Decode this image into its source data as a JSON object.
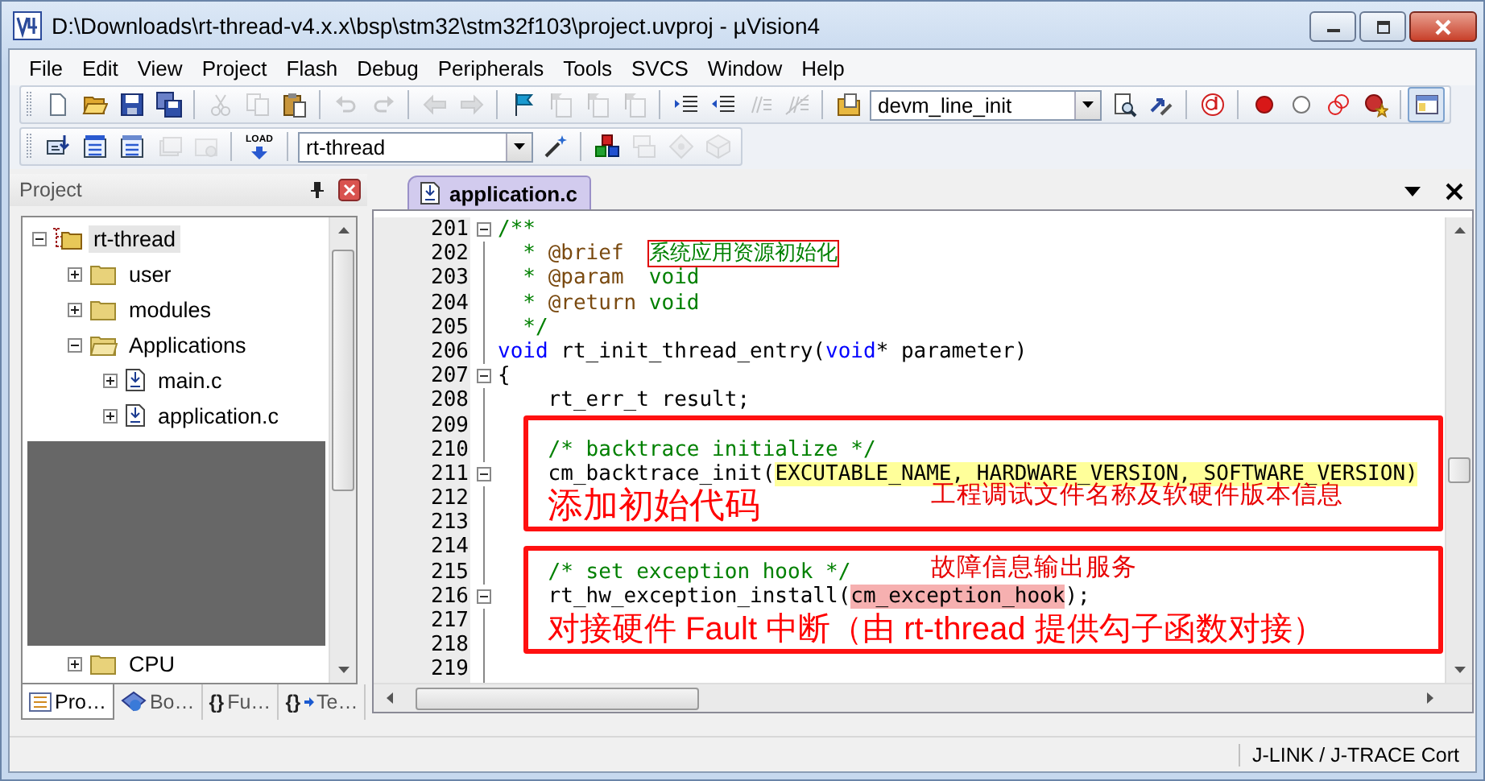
{
  "window": {
    "title": "D:\\Downloads\\rt-thread-v4.x.x\\bsp\\stm32\\stm32f103\\project.uvproj - µVision4"
  },
  "menu": [
    "File",
    "Edit",
    "View",
    "Project",
    "Flash",
    "Debug",
    "Peripherals",
    "Tools",
    "SVCS",
    "Window",
    "Help"
  ],
  "toolbars": [
    {
      "items": [
        {
          "kind": "new",
          "disabled": false,
          "pressed": false
        },
        {
          "kind": "open",
          "disabled": false,
          "pressed": false
        },
        {
          "kind": "save",
          "disabled": false,
          "pressed": false
        },
        {
          "kind": "saveall",
          "disabled": false,
          "pressed": false
        },
        {
          "kind": "separator"
        },
        {
          "kind": "cut",
          "disabled": true,
          "pressed": false
        },
        {
          "kind": "copy",
          "disabled": true,
          "pressed": false
        },
        {
          "kind": "paste",
          "disabled": false,
          "pressed": false
        },
        {
          "kind": "separator"
        },
        {
          "kind": "undo",
          "disabled": true,
          "pressed": false
        },
        {
          "kind": "redo",
          "disabled": true,
          "pressed": false
        },
        {
          "kind": "separator"
        },
        {
          "kind": "back",
          "disabled": true,
          "pressed": false
        },
        {
          "kind": "forward",
          "disabled": true,
          "pressed": false
        },
        {
          "kind": "separator"
        },
        {
          "kind": "bookmark",
          "disabled": false,
          "pressed": false
        },
        {
          "kind": "bmprev",
          "disabled": true,
          "pressed": false
        },
        {
          "kind": "bmnext",
          "disabled": true,
          "pressed": false
        },
        {
          "kind": "bmclear",
          "disabled": true,
          "pressed": false
        },
        {
          "kind": "separator"
        },
        {
          "kind": "indent",
          "disabled": false,
          "pressed": false
        },
        {
          "kind": "outdent",
          "disabled": false,
          "pressed": false
        },
        {
          "kind": "comment",
          "disabled": true,
          "pressed": false
        },
        {
          "kind": "uncomment",
          "disabled": true,
          "pressed": false
        },
        {
          "kind": "separator"
        },
        {
          "kind": "findfiles",
          "disabled": false,
          "pressed": false
        },
        {
          "kind": "dropdown",
          "value": "devm_line_init"
        },
        {
          "kind": "find",
          "disabled": false,
          "pressed": false
        },
        {
          "kind": "arrows",
          "disabled": false,
          "pressed": false
        },
        {
          "kind": "separator"
        },
        {
          "kind": "debug",
          "disabled": false,
          "pressed": false
        },
        {
          "kind": "separator"
        },
        {
          "kind": "bp",
          "disabled": false,
          "pressed": false
        },
        {
          "kind": "bpoff",
          "disabled": false,
          "pressed": false
        },
        {
          "kind": "bpdis",
          "disabled": false,
          "pressed": false
        },
        {
          "kind": "bpkill",
          "disabled": false,
          "pressed": false
        },
        {
          "kind": "separator"
        },
        {
          "kind": "winview",
          "disabled": false,
          "pressed": true
        }
      ]
    },
    {
      "items": [
        {
          "kind": "translate",
          "disabled": false,
          "pressed": false
        },
        {
          "kind": "build",
          "disabled": false,
          "pressed": false
        },
        {
          "kind": "rebuild",
          "disabled": false,
          "pressed": false
        },
        {
          "kind": "batch",
          "disabled": true,
          "pressed": false
        },
        {
          "kind": "stop",
          "disabled": true,
          "pressed": false
        },
        {
          "kind": "separator"
        },
        {
          "kind": "load",
          "label": "LOAD",
          "disabled": false,
          "pressed": false
        },
        {
          "kind": "separator"
        },
        {
          "kind": "dropdown",
          "value": "rt-thread"
        },
        {
          "kind": "wand",
          "disabled": false,
          "pressed": false
        },
        {
          "kind": "separator"
        },
        {
          "kind": "options",
          "disabled": false,
          "pressed": false
        },
        {
          "kind": "manage",
          "disabled": true,
          "pressed": false
        },
        {
          "kind": "pack",
          "disabled": true,
          "pressed": false
        },
        {
          "kind": "env",
          "disabled": true,
          "pressed": false
        }
      ]
    }
  ],
  "project": {
    "title": "Project",
    "tree": [
      {
        "label": "rt-thread",
        "kind": "project",
        "expanded": true,
        "selected": true,
        "children": [
          {
            "label": "user",
            "kind": "folder",
            "expanded": false,
            "selected": false
          },
          {
            "label": "modules",
            "kind": "folder",
            "expanded": false,
            "selected": false
          },
          {
            "label": "Applications",
            "kind": "folder",
            "expanded": true,
            "selected": false,
            "children": [
              {
                "label": "main.c",
                "kind": "file",
                "expanded": false,
                "selected": false
              },
              {
                "label": "application.c",
                "kind": "file",
                "expanded": false,
                "selected": false
              }
            ]
          },
          {
            "label": "CPU",
            "kind": "folder",
            "expanded": false,
            "selected": false
          }
        ]
      }
    ],
    "tabs": [
      {
        "label": "Pro…",
        "kind": "project",
        "selected": true
      },
      {
        "label": "Bo…",
        "kind": "books",
        "selected": false
      },
      {
        "label": "Fu…",
        "kind": "functions",
        "glyph": "{}",
        "selected": false
      },
      {
        "label": "Te…",
        "kind": "templates",
        "glyph": "{}",
        "selected": false
      }
    ]
  },
  "editor": {
    "tabs": [
      {
        "label": "application.c",
        "selected": true
      }
    ],
    "lines": [
      {
        "number": "201",
        "foldable": true,
        "tokens": [
          {
            "kind": "comment",
            "text": "/**"
          }
        ]
      },
      {
        "number": "202",
        "foldable": false,
        "tokens": [
          {
            "kind": "comment",
            "text": "  * "
          },
          {
            "kind": "doctag",
            "text": "@brief  "
          },
          {
            "kind": "boxed",
            "text": "系统应用资源初始化"
          }
        ]
      },
      {
        "number": "203",
        "foldable": false,
        "tokens": [
          {
            "kind": "comment",
            "text": "  * "
          },
          {
            "kind": "doctag",
            "text": "@param"
          },
          {
            "kind": "comment",
            "text": "  void"
          }
        ]
      },
      {
        "number": "204",
        "foldable": false,
        "tokens": [
          {
            "kind": "comment",
            "text": "  * "
          },
          {
            "kind": "doctag",
            "text": "@return"
          },
          {
            "kind": "comment",
            "text": " void"
          }
        ]
      },
      {
        "number": "205",
        "foldable": false,
        "tokens": [
          {
            "kind": "comment",
            "text": "  */"
          }
        ]
      },
      {
        "number": "206",
        "foldable": false,
        "tokens": [
          {
            "kind": "keyword",
            "text": "void"
          },
          {
            "kind": "plain",
            "text": " rt_init_thread_entry("
          },
          {
            "kind": "keyword",
            "text": "void"
          },
          {
            "kind": "plain",
            "text": "* parameter)"
          }
        ]
      },
      {
        "number": "207",
        "foldable": true,
        "tokens": [
          {
            "kind": "plain",
            "text": "{"
          }
        ]
      },
      {
        "number": "208",
        "foldable": false,
        "tokens": [
          {
            "kind": "plain",
            "text": "    rt_err_t result;"
          }
        ]
      },
      {
        "number": "209",
        "foldable": false
      },
      {
        "number": "210",
        "foldable": false,
        "tokens": [
          {
            "kind": "comment",
            "text": "    /* backtrace initialize */"
          }
        ]
      },
      {
        "number": "211",
        "foldable": true,
        "tokens": [
          {
            "kind": "plain",
            "text": "    cm_backtrace_init("
          },
          {
            "kind": "highlight",
            "text": "EXCUTABLE_NAME, HARDWARE_VERSION, SOFTWARE_VERSION)"
          }
        ]
      },
      {
        "number": "212",
        "foldable": false
      },
      {
        "number": "213",
        "foldable": false
      },
      {
        "number": "214",
        "foldable": false
      },
      {
        "number": "215",
        "foldable": false,
        "tokens": [
          {
            "kind": "comment",
            "text": "    /* set exception hook */"
          }
        ]
      },
      {
        "number": "216",
        "foldable": true,
        "tokens": [
          {
            "kind": "plain",
            "text": "    rt_hw_exception_install("
          },
          {
            "kind": "match",
            "text": "cm_exception_hook"
          },
          {
            "kind": "plain",
            "text": ");"
          }
        ]
      },
      {
        "number": "217",
        "foldable": false
      },
      {
        "number": "218",
        "foldable": false
      },
      {
        "number": "219",
        "foldable": false
      }
    ],
    "annotations": [
      {
        "text": "添加初始代码",
        "note": "工程调试文件名称及软硬件版本信息"
      },
      {
        "note": "故障信息输出服务",
        "text": "对接硬件 Fault 中断（由 rt-thread 提供勾子函数对接）"
      }
    ]
  },
  "status_bar": {
    "text": "J-LINK / J-TRACE Cort"
  }
}
